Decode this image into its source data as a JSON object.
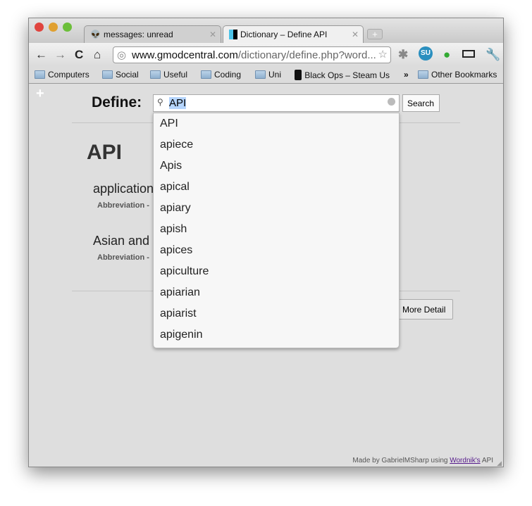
{
  "browser": {
    "tabs": [
      {
        "label": "messages: unread"
      },
      {
        "label": "Dictionary – Define API"
      }
    ],
    "url_host": "www.gmodcentral.com",
    "url_path": "/dictionary/define.php?word...",
    "bookmarks": [
      "Computers",
      "Social",
      "Useful",
      "Coding",
      "Uni",
      "Black Ops – Steam Us",
      "Other Bookmarks"
    ],
    "overflow": "»"
  },
  "page": {
    "define_label": "Define:",
    "search_value": "API",
    "search_button": "Search",
    "word": "API",
    "definitions": [
      {
        "text": "application",
        "pos": "Abbreviation -"
      },
      {
        "text": "Asian and",
        "pos": "Abbreviation -"
      }
    ],
    "more_detail": "More Detail",
    "footer_prefix": "Made by GabrielMSharp using ",
    "footer_link": "Wordnik's",
    "footer_suffix": " API",
    "suggestions": [
      "API",
      "apiece",
      "Apis",
      "apical",
      "apiary",
      "apish",
      "apices",
      "apiculture",
      "apiarian",
      "apiarist",
      "apigenin"
    ]
  }
}
